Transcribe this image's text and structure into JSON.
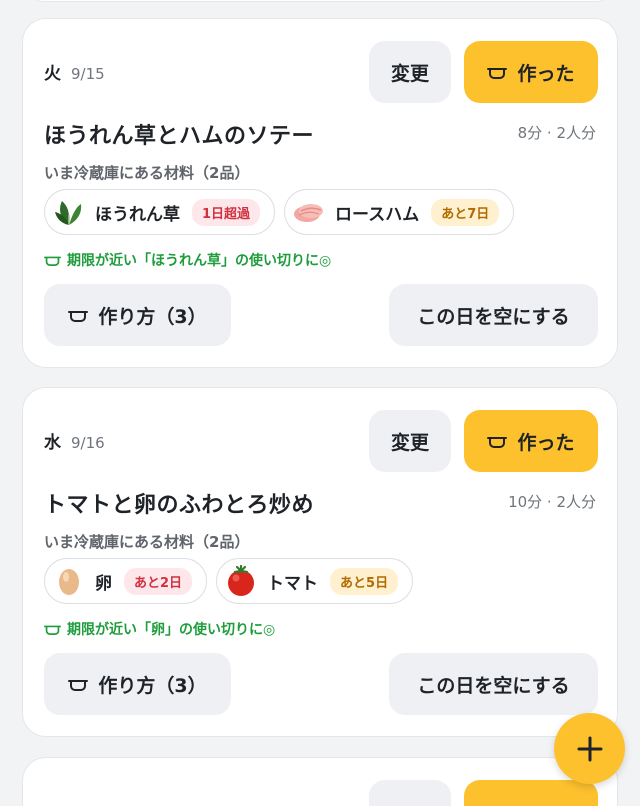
{
  "days": [
    {
      "weekday": "火",
      "date": "9/15",
      "change_label": "変更",
      "made_label": "作った",
      "recipe_title": "ほうれん草とハムのソテー",
      "meta": "8分 · 2人分",
      "inventory_label": "いま冷蔵庫にある材料（2品）",
      "ingredients": [
        {
          "name": "ほうれん草",
          "badge": "1日超過",
          "badge_tone": "red",
          "icon": "spinach-icon"
        },
        {
          "name": "ロースハム",
          "badge": "あと7日",
          "badge_tone": "amber",
          "icon": "ham-icon"
        }
      ],
      "hint": "期限が近い「ほうれん草」の使い切りに◎",
      "howto_label": "作り方（3）",
      "clear_label": "この日を空にする"
    },
    {
      "weekday": "水",
      "date": "9/16",
      "change_label": "変更",
      "made_label": "作った",
      "recipe_title": "トマトと卵のふわとろ炒め",
      "meta": "10分 · 2人分",
      "inventory_label": "いま冷蔵庫にある材料（2品）",
      "ingredients": [
        {
          "name": "卵",
          "badge": "あと2日",
          "badge_tone": "red",
          "icon": "egg-icon"
        },
        {
          "name": "トマト",
          "badge": "あと5日",
          "badge_tone": "amber",
          "icon": "tomato-icon"
        }
      ],
      "hint": "期限が近い「卵」の使い切りに◎",
      "howto_label": "作り方（3）",
      "clear_label": "この日を空にする"
    }
  ],
  "fab": {
    "icon": "plus-icon"
  },
  "colors": {
    "accent": "#fdc12e",
    "hint_green": "#1f9d3d",
    "badge_red": "#d0313f",
    "badge_amber": "#b26a00"
  }
}
